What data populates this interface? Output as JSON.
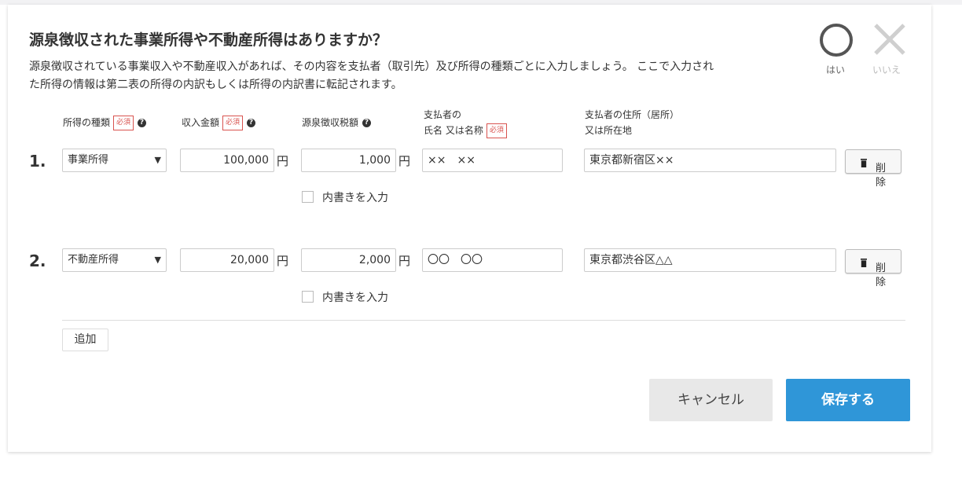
{
  "dialog": {
    "title": "源泉徴収された事業所得や不動産所得はありますか？",
    "description": "源泉徴収されている事業収入や不動産収入があれば、その内容を支払者（取引先）及び所得の種類ごとに入力しましょう。 ここで入力された所得の情報は第二表の所得の内訳もしくは所得の内訳書に転記されます。",
    "yes_label": "はい",
    "no_label": "いいえ",
    "selected": "yes"
  },
  "headers": {
    "income_type": "所得の種類",
    "income_amount": "収入金額",
    "withholding": "源泉徴収税額",
    "payer_line1": "支払者の",
    "payer_line2": "氏名 又は名称",
    "address_line1": "支払者の住所（居所）",
    "address_line2": "又は所在地",
    "required_badge": "必須",
    "help_glyph": "?"
  },
  "rows": [
    {
      "number": "1.",
      "income_type": "事業所得",
      "amount": "100,000",
      "withholding": "1,000",
      "payer": "××　××",
      "address": "東京都新宿区××",
      "breakdown_label": "内書きを入力",
      "breakdown_checked": false
    },
    {
      "number": "2.",
      "income_type": "不動産所得",
      "amount": "20,000",
      "withholding": "2,000",
      "payer": "〇〇　〇〇",
      "address": "東京都渋谷区△△",
      "breakdown_label": "内書きを入力",
      "breakdown_checked": false
    }
  ],
  "labels": {
    "currency_unit": "円",
    "select_arrow": "▼",
    "delete_line1": "削",
    "delete_line2": "除",
    "add": "追加",
    "cancel": "キャンセル",
    "save": "保存する"
  },
  "colors": {
    "accent": "#2f96d8",
    "required": "#d9534f",
    "cancel_bg": "#e8e8e8"
  },
  "icons": {
    "yes": "circle-icon",
    "no": "cross-icon",
    "delete": "trash-icon",
    "help": "question-circle-icon",
    "select": "triangle-down-icon"
  }
}
